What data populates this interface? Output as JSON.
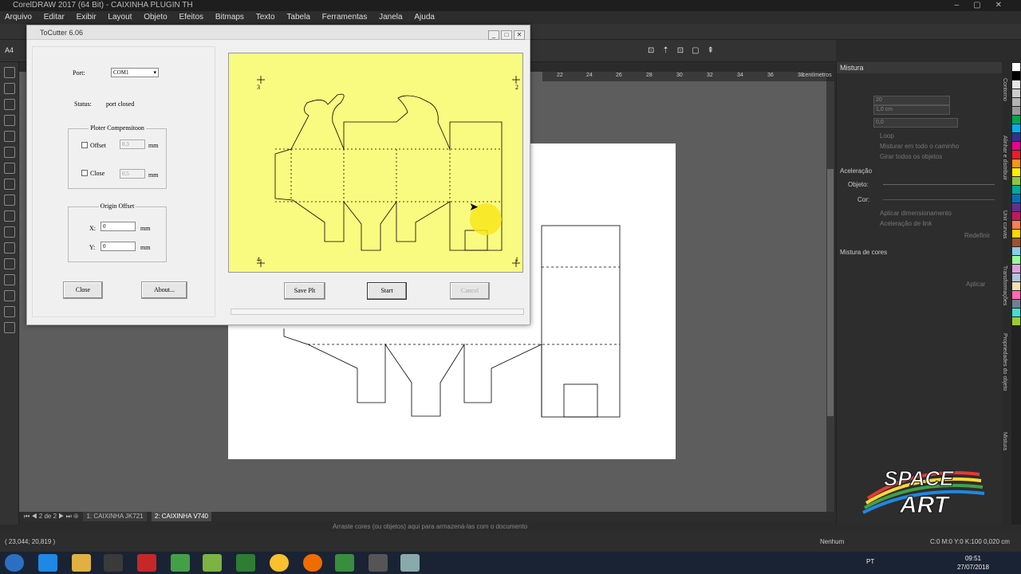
{
  "app": {
    "title": "CorelDRAW 2017 (64 Bit) - CAIXINHA PLUGIN TH",
    "menu": [
      "Arquivo",
      "Editar",
      "Exibir",
      "Layout",
      "Objeto",
      "Efeitos",
      "Bitmaps",
      "Texto",
      "Tabela",
      "Ferramentas",
      "Janela",
      "Ajuda"
    ],
    "page_size": "A4",
    "ruler_ticks": [
      "22",
      "24",
      "26",
      "28",
      "30",
      "32",
      "34",
      "36",
      "38"
    ],
    "ruler_unit": "centímetros"
  },
  "dialog": {
    "title": "ToCutter 6.06",
    "port_label": "Port:",
    "port_value": "COM1",
    "status_label": "Status:",
    "status_value": "port closed",
    "comp_group": "Ploter Compensitoon",
    "offset_label": "Offset",
    "offset_value": "0.3",
    "offset_unit": "mm",
    "close_label": "Close",
    "close_value": "0.5",
    "close_unit": "mm",
    "origin_group": "Origin Offset",
    "x_label": "X:",
    "x_value": "0",
    "x_unit": "mm",
    "y_label": "Y:",
    "y_value": "0",
    "y_unit": "mm",
    "btn_close": "Close",
    "btn_about": "About...",
    "btn_save": "Save Plt",
    "btn_start": "Start",
    "btn_cancel": "Cancel",
    "corner_3": "3",
    "corner_2": "2",
    "corner_4": "4",
    "corner_1": "1"
  },
  "right_panel": {
    "title": "Mistura",
    "steps_value": "20",
    "spacing_value": "1,0 cm",
    "angle_value": "0,0",
    "loop_label": "Loop",
    "misturar_label": "Misturar em todo o caminho",
    "girar_label": "Girar todos os objetos",
    "aceleracao_label": "Aceleração",
    "objeto_label": "Objeto:",
    "cor_label": "Cor:",
    "aplicar_dim_label": "Aplicar dimensionamento",
    "aceleracao_link_label": "Aceleração de link",
    "redefinir_label": "Redefinir",
    "mistura_cores_label": "Mistura de cores",
    "aplicar_label": "Aplicar"
  },
  "docker_tabs": [
    "Contorno",
    "Alinhar e distribuir",
    "Unir curvas",
    "Transformações",
    "Propriedades do objeto",
    "Mistura"
  ],
  "page_nav": {
    "current": "2",
    "of": "de",
    "total": "2",
    "tab1": "1: CAIXINHA JK721",
    "tab2": "2: CAIXINHA V740"
  },
  "color_hint": "Arraste cores (ou objetos) aqui para armazená-las com o documento",
  "status": {
    "coords": "( 23,044; 20,819 )",
    "fill_label": "Nenhum",
    "outline": "C:0 M:0 Y:0 K:100  0,020 cm"
  },
  "taskbar": {
    "lang": "PT",
    "time": "09:51",
    "date": "27/07/2018"
  },
  "watermark": {
    "line1": "SPACE",
    "line2": "ART"
  },
  "palette_colors": [
    "#ffffff",
    "#000000",
    "#e6e6e6",
    "#cccccc",
    "#b3b3b3",
    "#999999",
    "#00a651",
    "#00aeef",
    "#2e3192",
    "#ec008c",
    "#ed1c24",
    "#f7941d",
    "#fff200",
    "#8dc63f",
    "#00a99d",
    "#0072bc",
    "#662d91",
    "#c2185b",
    "#ff7f50",
    "#ffd700",
    "#a0522d",
    "#87ceeb",
    "#98fb98",
    "#dda0dd",
    "#b0c4de",
    "#f5deb3",
    "#ff69b4",
    "#708090",
    "#40e0d0",
    "#9acd32"
  ]
}
